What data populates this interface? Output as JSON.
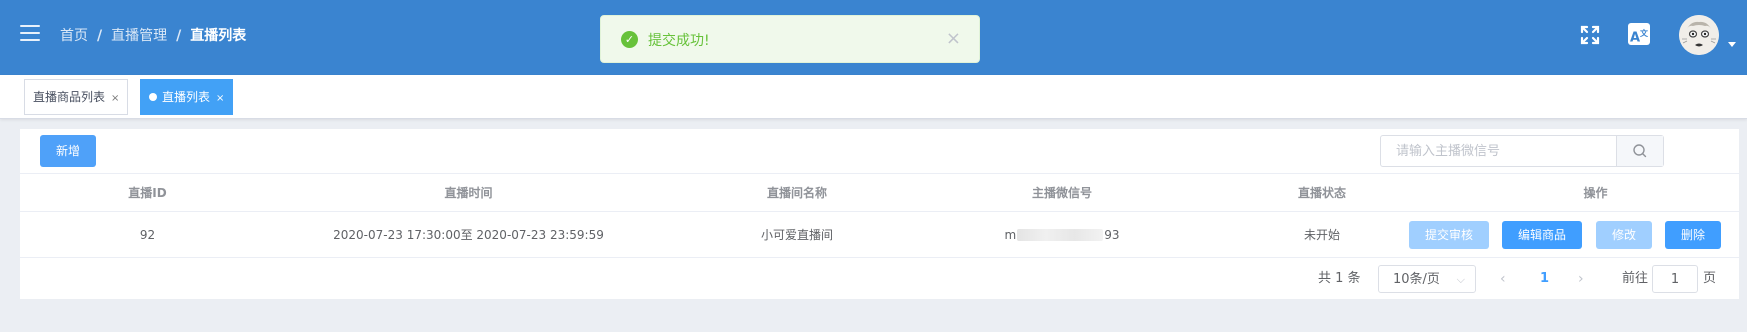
{
  "header": {
    "breadcrumb": [
      "首页",
      "直播管理",
      "直播列表"
    ],
    "breadcrumb_sep": "/",
    "colors": {
      "topbar": "#3a84d0",
      "primary": "#409eff"
    }
  },
  "toast": {
    "message": "提交成功!",
    "type": "success",
    "color": "#67c23a"
  },
  "translate_icon_text": "A",
  "translate_icon_sup": "文",
  "tabs": [
    {
      "label": "直播商品列表",
      "active": false,
      "close": "×"
    },
    {
      "label": "直播列表",
      "active": true,
      "close": "×"
    }
  ],
  "toolbar": {
    "add_label": "新增",
    "search_placeholder": "请输入主播微信号"
  },
  "table": {
    "columns": [
      "直播ID",
      "直播时间",
      "直播间名称",
      "主播微信号",
      "直播状态",
      "操作"
    ],
    "rows": [
      {
        "id": "92",
        "time": "2020-07-23 17:30:00至 2020-07-23 23:59:59",
        "room_name": "小可爱直播间",
        "wechat_prefix": "m",
        "wechat_suffix": "93",
        "status": "未开始",
        "actions": [
          "提交审核",
          "编辑商品",
          "修改",
          "删除"
        ]
      }
    ]
  },
  "pagination": {
    "total_label": "共 1 条",
    "page_size": "10条/页",
    "prev": "‹",
    "current_page": "1",
    "next": "›",
    "goto_label": "前往",
    "goto_value": "1",
    "goto_unit": "页"
  }
}
